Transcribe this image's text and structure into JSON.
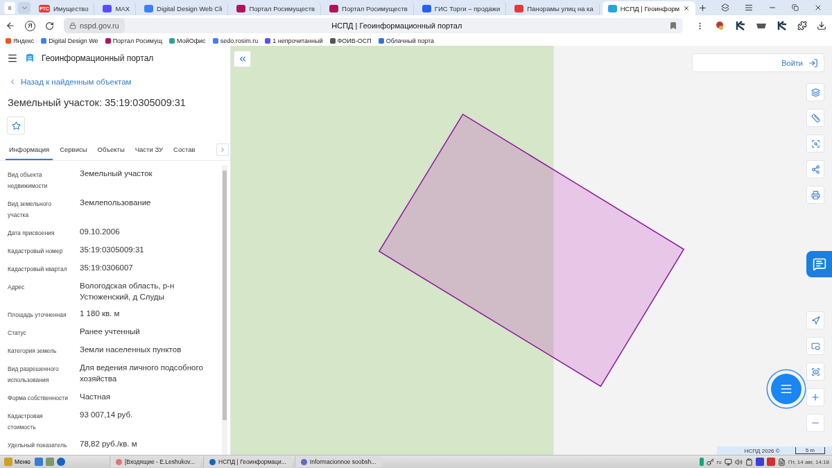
{
  "browser": {
    "tab_count": "8",
    "tabs": [
      {
        "title": "Имущество",
        "icon_text": "РТС",
        "color": "#e53935",
        "selected": false
      },
      {
        "title": "MAX",
        "color": "#5b4dff",
        "selected": false
      },
      {
        "title": "Digital Design Web Cli",
        "color": "#3b82f6",
        "selected": false
      },
      {
        "title": "Портал Росимуществ",
        "color": "#b0135c",
        "selected": false
      },
      {
        "title": "Портал Росимуществ",
        "color": "#b0135c",
        "selected": false
      },
      {
        "title": "ГИС Торги – продажи",
        "color": "#2563eb",
        "selected": false
      },
      {
        "title": "Панорамы улиц на ка",
        "color": "#e53935",
        "selected": false
      },
      {
        "title": "НСПД | Геоинформ",
        "color": "#29a3e0",
        "selected": true
      }
    ],
    "home_glyph": "Я",
    "address": "nspd.gov.ru",
    "page_title": "НСПД | Геоинформационный портал",
    "bookmarks": [
      {
        "title": "Яндекс",
        "color": "#f4511e"
      },
      {
        "title": "Digital Design We",
        "color": "#3b82f6"
      },
      {
        "title": "Портал Росимущ",
        "color": "#b0135c"
      },
      {
        "title": "МойОфис",
        "color": "#26a69a"
      },
      {
        "title": "sedo.rosim.ru",
        "color": "#3b82f6"
      },
      {
        "title": "1 непрочитанный",
        "color": "#5b4dff"
      },
      {
        "title": "ФОИВ-ОСП",
        "color": "#555555"
      },
      {
        "title": "Облачный порта",
        "color": "#3a6fd8"
      }
    ]
  },
  "portal": {
    "title": "Геоинформационный портал",
    "back_link": "Назад к найденным объектам",
    "object_title": "Земельный участок: 35:19:0305009:31",
    "tabs": [
      {
        "label": "Информация",
        "selected": true
      },
      {
        "label": "Сервисы",
        "selected": false
      },
      {
        "label": "Объекты",
        "selected": false
      },
      {
        "label": "Части ЗУ",
        "selected": false
      },
      {
        "label": "Состав",
        "selected": false
      }
    ],
    "fields": [
      {
        "label": "Вид объекта недвижимости",
        "value": "Земельный участок"
      },
      {
        "label": "Вид земельного участка",
        "value": "Землепользование"
      },
      {
        "label": "Дата присвоения",
        "value": "09.10.2006"
      },
      {
        "label": "Кадастровый номер",
        "value": "35:19:0305009:31"
      },
      {
        "label": "Кадастровый квартал",
        "value": "35:19:0306007"
      },
      {
        "label": "Адрес",
        "value": "Вологодская область, р-н Устюженский, д Слуды"
      },
      {
        "label": "Площадь уточненная",
        "value": "1 180 кв. м"
      },
      {
        "label": "Статус",
        "value": "Ранее учтенный"
      },
      {
        "label": "Категория земель",
        "value": "Земли населенных пунктов"
      },
      {
        "label": "Вид разрешенного использования",
        "value": "Для ведения личного подсобного хозяйства"
      },
      {
        "label": "Форма собственности",
        "value": "Частная"
      },
      {
        "label": "Кадастровая стоимость",
        "value": "93 007,14 руб."
      },
      {
        "label": "Удельный показатель",
        "value": "78,82 руб./кв. м"
      }
    ]
  },
  "map": {
    "login": "Войти",
    "attribution": "НСПД 2026 ©",
    "scale": "5 m"
  },
  "taskbar": {
    "menu": "Меню",
    "windows": [
      {
        "title": "[Входящие - E.Leshukov...",
        "color": "#e57373"
      },
      {
        "title": "НСПД | Геоинформаци...",
        "color": "#1565c0"
      },
      {
        "title": "Informacionnoe soobsh...",
        "color": "#5c6bc0"
      }
    ],
    "language": "ru",
    "clock": "Пт, 14 авг, 14:18"
  }
}
